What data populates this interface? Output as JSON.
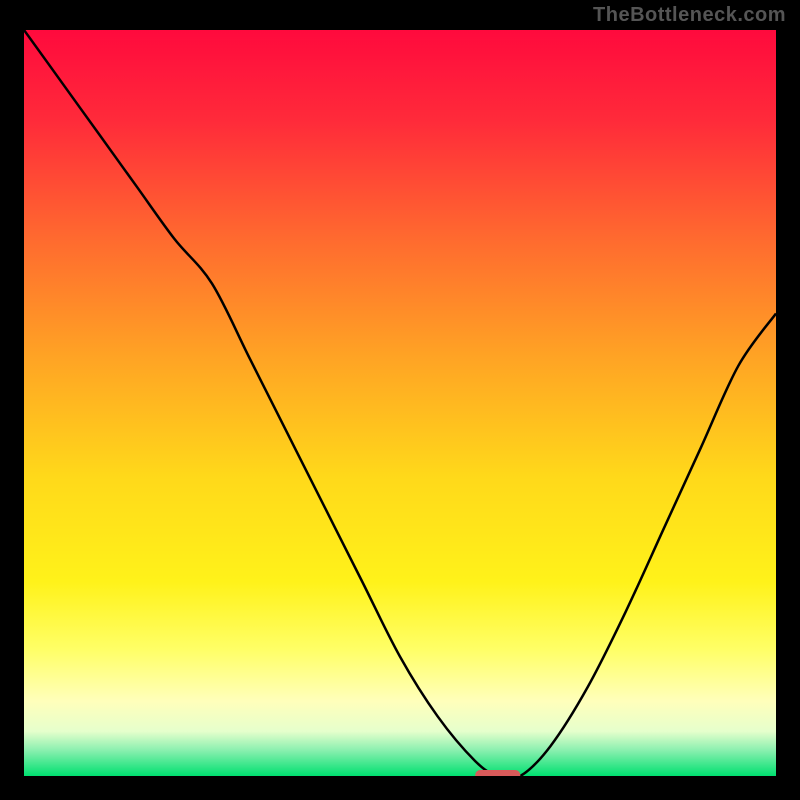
{
  "watermark": "TheBottleneck.com",
  "colors": {
    "frame": "#000000",
    "curve": "#000000",
    "marker": "#d85a5a",
    "gradient_stops": [
      {
        "offset": 0.0,
        "color": "#ff0a3d"
      },
      {
        "offset": 0.12,
        "color": "#ff2a3a"
      },
      {
        "offset": 0.28,
        "color": "#ff6a2f"
      },
      {
        "offset": 0.44,
        "color": "#ffa424"
      },
      {
        "offset": 0.6,
        "color": "#ffd91a"
      },
      {
        "offset": 0.74,
        "color": "#fff21a"
      },
      {
        "offset": 0.83,
        "color": "#ffff66"
      },
      {
        "offset": 0.9,
        "color": "#ffffbb"
      },
      {
        "offset": 0.94,
        "color": "#e6ffcc"
      },
      {
        "offset": 0.965,
        "color": "#8cf0b0"
      },
      {
        "offset": 1.0,
        "color": "#00e070"
      }
    ]
  },
  "chart_data": {
    "type": "line",
    "title": "",
    "xlabel": "",
    "ylabel": "",
    "xlim": [
      0,
      100
    ],
    "ylim": [
      0,
      100
    ],
    "grid": false,
    "x": [
      0,
      5,
      10,
      15,
      20,
      25,
      30,
      35,
      40,
      45,
      50,
      55,
      60,
      63,
      66,
      70,
      75,
      80,
      85,
      90,
      95,
      100
    ],
    "values": [
      100,
      93,
      86,
      79,
      72,
      66,
      56,
      46,
      36,
      26,
      16,
      8,
      2,
      0,
      0,
      4,
      12,
      22,
      33,
      44,
      55,
      62
    ],
    "marker": {
      "x_range": [
        60,
        66
      ],
      "y": 0
    }
  }
}
